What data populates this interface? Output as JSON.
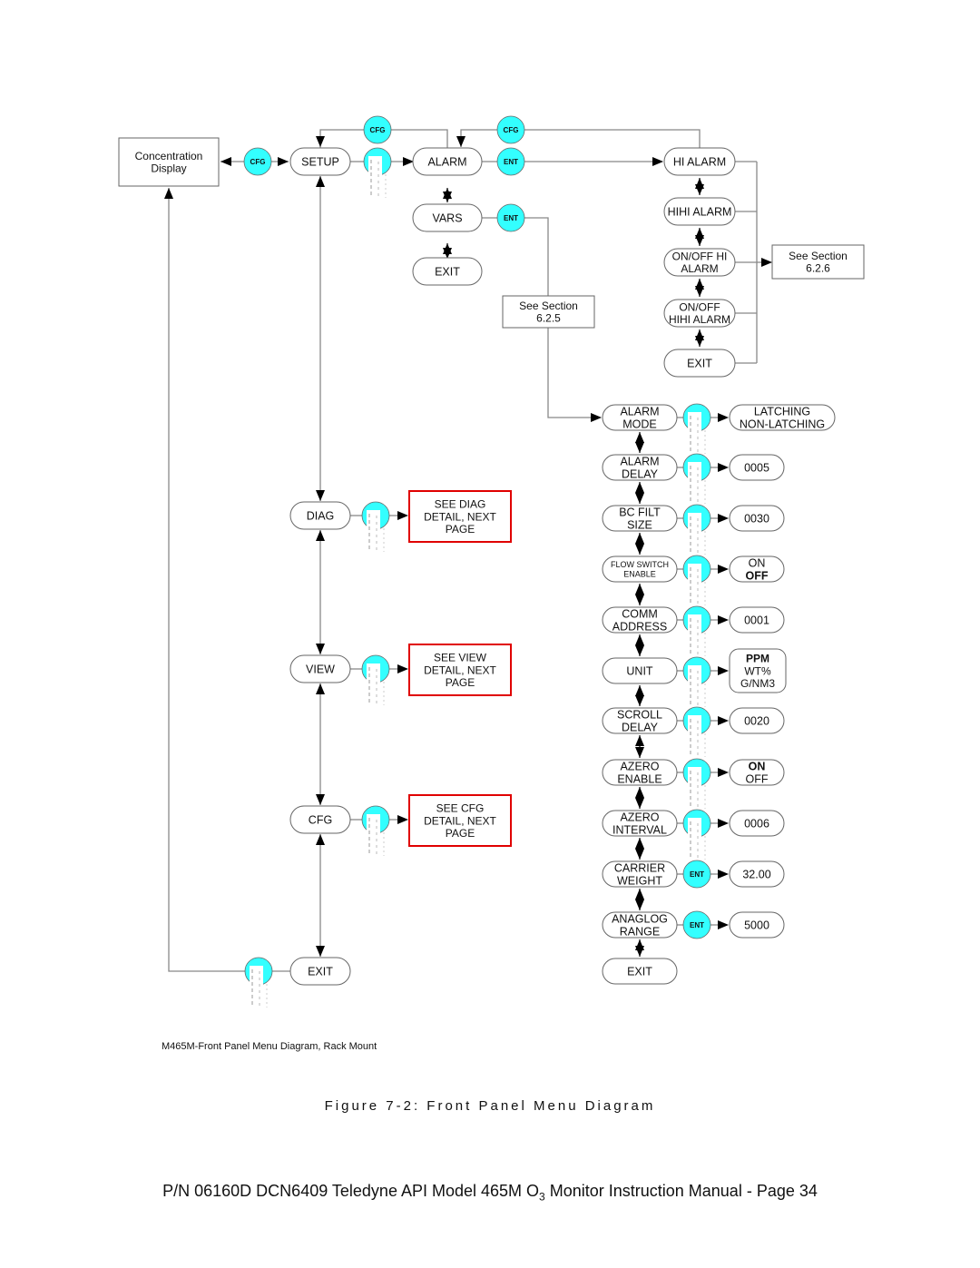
{
  "diagram": {
    "concentration_display": [
      "Concentration",
      "Display"
    ],
    "main_menu": {
      "setup": "SETUP",
      "diag": "DIAG",
      "view": "VIEW",
      "cfg": "CFG",
      "exit": "EXIT"
    },
    "setup_menu": {
      "alarm": "ALARM",
      "vars": "VARS",
      "exit": "EXIT"
    },
    "alarm_menu": {
      "items": [
        [
          "HI ALARM"
        ],
        [
          "HIHI ALARM"
        ],
        [
          "ON/OFF HI",
          "ALARM"
        ],
        [
          "ON/OFF",
          "HIHI ALARM"
        ],
        [
          "EXIT"
        ]
      ],
      "see_section": [
        "See Section",
        "6.2.6"
      ]
    },
    "vars_see_section": [
      "See Section",
      "6.2.5"
    ],
    "red_boxes": {
      "diag": [
        "SEE DIAG",
        "DETAIL, NEXT",
        "PAGE"
      ],
      "view": [
        "SEE VIEW",
        "DETAIL, NEXT",
        "PAGE"
      ],
      "cfg": [
        "SEE CFG",
        "DETAIL, NEXT",
        "PAGE"
      ]
    },
    "keys": {
      "cfg": "CFG",
      "ent": "ENT"
    },
    "vars_menu": [
      {
        "label": [
          "ALARM",
          "MODE"
        ],
        "key": "scroll",
        "values": [
          {
            "t": "LATCHING",
            "b": false
          },
          {
            "t": "NON-LATCHING",
            "b": false
          }
        ]
      },
      {
        "label": [
          "ALARM",
          "DELAY"
        ],
        "key": "scroll",
        "values": [
          {
            "t": "0005",
            "b": false
          }
        ]
      },
      {
        "label": [
          "BC FILT",
          "SIZE"
        ],
        "key": "scroll",
        "values": [
          {
            "t": "0030",
            "b": false
          }
        ]
      },
      {
        "label": [
          "FLOW SWITCH",
          "ENABLE"
        ],
        "small": true,
        "key": "scroll",
        "values": [
          {
            "t": "ON",
            "b": false
          },
          {
            "t": "OFF",
            "b": true
          }
        ]
      },
      {
        "label": [
          "COMM",
          "ADDRESS"
        ],
        "key": "scroll",
        "values": [
          {
            "t": "0001",
            "b": false
          }
        ]
      },
      {
        "label": [
          "UNIT"
        ],
        "key": "scroll",
        "values": [
          {
            "t": "PPM",
            "b": true
          },
          {
            "t": "WT%",
            "b": false
          },
          {
            "t": "G/NM3",
            "b": false
          }
        ]
      },
      {
        "label": [
          "SCROLL",
          "DELAY"
        ],
        "key": "scroll",
        "values": [
          {
            "t": "0020",
            "b": false
          }
        ]
      },
      {
        "label": [
          "AZERO",
          "ENABLE"
        ],
        "key": "scroll",
        "values": [
          {
            "t": "ON",
            "b": true
          },
          {
            "t": "OFF",
            "b": false
          }
        ]
      },
      {
        "label": [
          "AZERO",
          "INTERVAL"
        ],
        "key": "scroll",
        "values": [
          {
            "t": "0006",
            "b": false
          }
        ]
      },
      {
        "label": [
          "CARRIER",
          "WEIGHT"
        ],
        "key": "ent",
        "values": [
          {
            "t": "32.00",
            "b": false
          }
        ]
      },
      {
        "label": [
          "ANAGLOG",
          "RANGE"
        ],
        "key": "ent",
        "values": [
          {
            "t": "5000",
            "b": false
          }
        ]
      },
      {
        "label": [
          "EXIT"
        ],
        "key": null,
        "values": []
      }
    ],
    "colors": {
      "key_fill": "#33ffff",
      "red_box": "#e00000",
      "line": "#888888"
    }
  },
  "caption": "M465M-Front Panel Menu Diagram, Rack Mount",
  "figure_title": "Figure 7-2:  Front Panel Menu Diagram",
  "footer": {
    "prefix": "P/N 06160D DCN6409 Teledyne API Model 465M O",
    "sub": "3",
    "suffix": " Monitor Instruction Manual - Page 34"
  }
}
